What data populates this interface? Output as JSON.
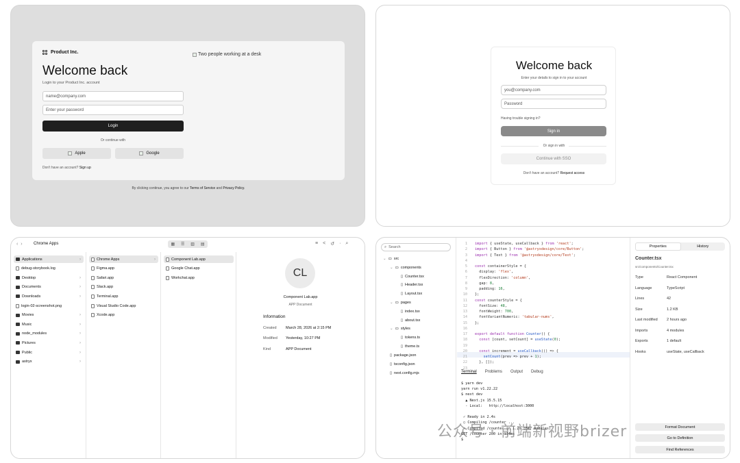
{
  "login1": {
    "brand": "Product Inc.",
    "title": "Welcome back",
    "subtitle": "Login to your Product Inc. account",
    "email_placeholder": "name@company.com",
    "password_placeholder": "Enter your password",
    "login_label": "Login",
    "divider": "Or continue with",
    "apple_label": "Apple",
    "google_label": "Google",
    "signup_prefix": "Don't have an account?",
    "signup_link": "Sign up",
    "image_alt": "Two people working at a desk",
    "footer_prefix": "By clicking continue, you agree to our",
    "footer_terms": "Terms of Service",
    "footer_and": "and",
    "footer_privacy": "Privacy Policy."
  },
  "login2": {
    "title": "Welcome back",
    "subtitle": "Enter your details to sign in to your account",
    "email_placeholder": "you@company.com",
    "password_placeholder": "Password",
    "trouble": "Having trouble signing in?",
    "signin_label": "Sign in",
    "divider": "Or sign in with",
    "sso_label": "Continue with SSO",
    "access_prefix": "Don't have an account?",
    "access_link": "Request access"
  },
  "finder": {
    "title": "Chrome Apps",
    "sidebar": [
      "Applications",
      "debug-storybook.log",
      "Desktop",
      "Documents",
      "Downloads",
      "login-02-screenshot.png",
      "Movies",
      "Music",
      "node_modules",
      "Pictures",
      "Public",
      "astryx"
    ],
    "col2": [
      "Chrome Apps",
      "Figma.app",
      "Safari.app",
      "Slack.app",
      "Terminal.app",
      "Visual Studio Code.app",
      "Xcode.app"
    ],
    "col3": [
      "Component Lab.app",
      "Google Chat.app",
      "Workchat.app"
    ],
    "preview": {
      "initials": "CL",
      "name": "Component Lab.app",
      "kind_label": "APP Document",
      "info_heading": "Information",
      "created_label": "Created",
      "created_value": "March 28, 2026 at 2:15 PM",
      "modified_label": "Modified",
      "modified_value": "Yesterday, 10:27 PM",
      "kind_key": "Kind",
      "kind_value": "APP Document"
    }
  },
  "ide": {
    "search_placeholder": "Search",
    "tree": {
      "src": "src",
      "components": "components",
      "counter": "Counter.tsx",
      "header": "Header.tsx",
      "layout": "Layout.tsx",
      "pages": "pages",
      "index": "index.tsx",
      "about": "about.tsx",
      "styles": "styles",
      "tokens": "tokens.ts",
      "theme": "theme.ts",
      "package": "package.json",
      "tsconfig": "tsconfig.json",
      "next": "next.config.mjs"
    },
    "tabs": [
      "Terminal",
      "Problems",
      "Output",
      "Debug"
    ],
    "terminal": [
      "$ yarn dev",
      "yarn run v1.22.22",
      "$ next dev",
      "  ▲ Next.js 15.5.15",
      "  - Local:   http://localhost:3000",
      "",
      " ✓ Ready in 2.4s",
      " ○ Compiling /counter ...",
      " ✓ Compiled /counter in 1.2s (847 modules)",
      "GET /counter 200 in 134ms",
      "$"
    ],
    "props_tab": "Properties",
    "history_tab": "History",
    "file_title": "Counter.tsx",
    "file_path": "src/components/Counter.tsx",
    "props": [
      {
        "k": "Type",
        "v": "React Component"
      },
      {
        "k": "Language",
        "v": "TypeScript"
      },
      {
        "k": "Lines",
        "v": "42"
      },
      {
        "k": "Size",
        "v": "1.2 KB"
      },
      {
        "k": "Last modified",
        "v": "2 hours ago"
      },
      {
        "k": "Imports",
        "v": "4 modules"
      },
      {
        "k": "Exports",
        "v": "1 default"
      },
      {
        "k": "Hooks",
        "v": "useState, useCallback"
      }
    ],
    "actions": [
      "Format Document",
      "Go to Definition",
      "Find References"
    ],
    "watermark": "公众号 · 前端新视野brizer"
  }
}
